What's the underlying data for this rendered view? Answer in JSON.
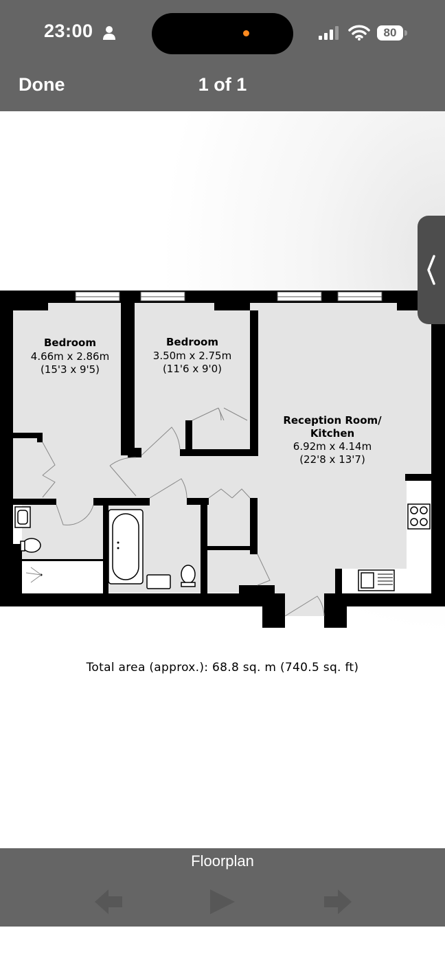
{
  "status_bar": {
    "time": "23:00",
    "battery": "80",
    "icons": [
      "person-icon",
      "signal-icon",
      "wifi-icon",
      "battery-icon"
    ]
  },
  "nav": {
    "done_label": "Done",
    "pager_title": "1 of 1"
  },
  "floorplan": {
    "rooms": [
      {
        "name": "Bedroom",
        "size_m": "4.66m x 2.86m",
        "size_ft": "(15'3 x 9'5)"
      },
      {
        "name": "Bedroom",
        "size_m": "3.50m x 2.75m",
        "size_ft": "(11'6 x 9'0)"
      },
      {
        "name_line1": "Reception Room/",
        "name_line2": "Kitchen",
        "size_m": "6.92m x 4.14m",
        "size_ft": "(22'8 x 13'7)"
      }
    ],
    "total_area": "Total area (approx.): 68.8 sq. m (740.5 sq. ft)"
  },
  "footer": {
    "caption": "Floorplan",
    "controls": [
      "back-arrow-icon",
      "play-icon",
      "forward-arrow-icon"
    ]
  },
  "colors": {
    "bars": "#656565",
    "walls": "#000000",
    "floor": "#e4e4e4",
    "footer_icons": "#575757"
  }
}
